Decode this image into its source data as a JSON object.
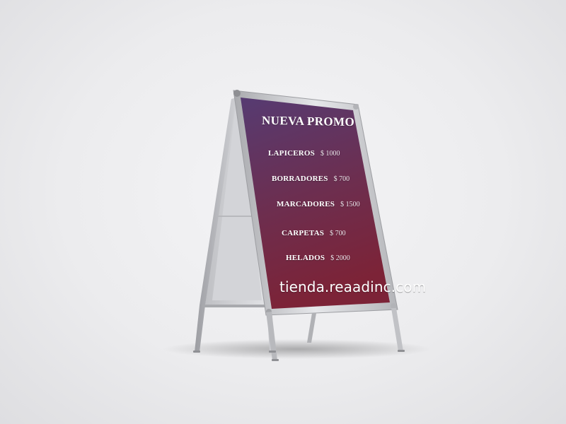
{
  "sign": {
    "title": "NUEVA PROMO",
    "items": [
      {
        "name": "LAPICEROS",
        "price": "$ 1000"
      },
      {
        "name": "BORRADORES",
        "price": "$ 700"
      },
      {
        "name": "MARCADORES",
        "price": "$ 1500"
      },
      {
        "name": "CARPETAS",
        "price": "$ 700"
      },
      {
        "name": "HELADOS",
        "price": "$ 2000"
      }
    ],
    "url": "tienda.reaadinc.com"
  },
  "colors": {
    "background": "#ececee",
    "panel_top": "#5a3a6e",
    "panel_bottom": "#7a2438",
    "frame": "#c9cacd",
    "text": "#ffffff"
  }
}
